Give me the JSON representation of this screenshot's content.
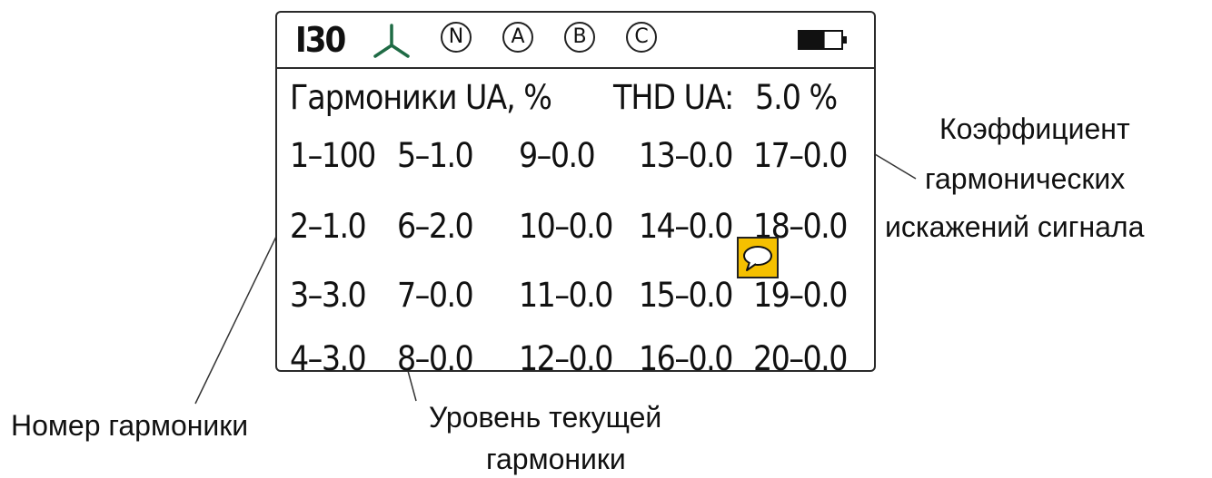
{
  "status_bar": {
    "range": "I30",
    "phase_labels": [
      "N",
      "A",
      "B",
      "C"
    ],
    "battery_level": 0.6,
    "phase_icon": "three-phase-star-icon",
    "battery_icon": "battery-icon"
  },
  "header": {
    "title": "Гармоники UA, %",
    "thd_label": "THD UA:",
    "thd_value": "5.0 %"
  },
  "harmonics": [
    [
      "1–100",
      "5–1.0",
      "9–0.0",
      "13–0.0",
      "17–0.0"
    ],
    [
      "2–1.0",
      "6–2.0",
      "10–0.0",
      "14–0.0",
      "18–0.0"
    ],
    [
      "3–3.0",
      "7–0.0",
      "11–0.0",
      "15–0.0",
      "19–0.0"
    ],
    [
      "4–3.0",
      "8–0.0",
      "12–0.0",
      "16–0.0",
      "20–0.0"
    ]
  ],
  "callouts": {
    "thd": [
      "Коэффициент",
      "гармонических",
      "искажений сигнала"
    ],
    "number": "Номер гармоники",
    "level": [
      "Уровень текущей",
      "гармоники"
    ]
  },
  "colors": {
    "lcd_border": "#2a2a2a",
    "phase_icon": "#1f6b45",
    "comment_bg": "#f5c000"
  }
}
